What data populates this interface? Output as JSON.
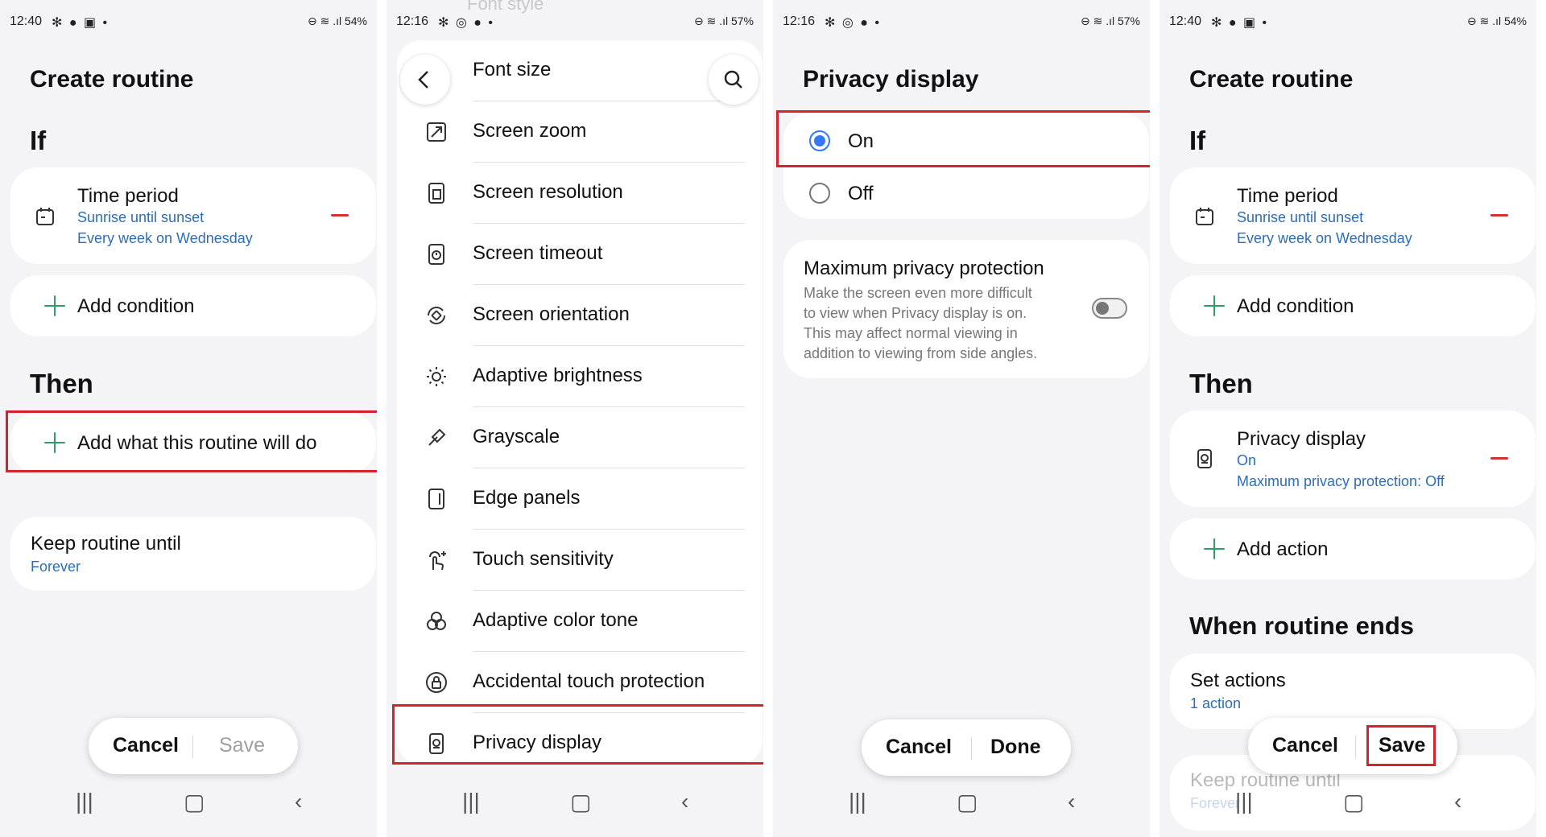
{
  "status_bars": [
    {
      "time": "12:40",
      "icons": "✻ ● ▣ •",
      "right": "⊖ ≋ .ıl 54%"
    },
    {
      "time": "12:16",
      "icons": "✻ ◎ ● •",
      "right": "⊖ ≋ .ıl 57%"
    },
    {
      "time": "12:16",
      "icons": "✻ ◎ ● •",
      "right": "⊖ ≋ .ıl 57%"
    },
    {
      "time": "12:40",
      "icons": "✻ ● ▣ •",
      "right": "⊖ ≋ .ıl 54%"
    }
  ],
  "screen1": {
    "title": "Create routine",
    "if_label": "If",
    "condition": {
      "title": "Time period",
      "line1": "Sunrise until sunset",
      "line2": "Every week on  Wednesday"
    },
    "add_condition": "Add condition",
    "then_label": "Then",
    "add_action": "Add what this routine will do",
    "keep": {
      "title": "Keep routine until",
      "value": "Forever"
    },
    "buttons": {
      "cancel": "Cancel",
      "save": "Save"
    }
  },
  "screen2": {
    "top_partial": "Font style",
    "items": [
      {
        "label": "Font size",
        "icon": "font-size-icon"
      },
      {
        "label": "Screen zoom",
        "icon": "screen-zoom-icon"
      },
      {
        "label": "Screen resolution",
        "icon": "screen-resolution-icon"
      },
      {
        "label": "Screen timeout",
        "icon": "screen-timeout-icon"
      },
      {
        "label": "Screen orientation",
        "icon": "screen-orientation-icon"
      },
      {
        "label": "Adaptive brightness",
        "icon": "brightness-icon"
      },
      {
        "label": "Grayscale",
        "icon": "grayscale-icon"
      },
      {
        "label": "Edge panels",
        "icon": "edge-panels-icon"
      },
      {
        "label": "Touch sensitivity",
        "icon": "touch-sensitivity-icon"
      },
      {
        "label": "Adaptive color tone",
        "icon": "color-tone-icon"
      },
      {
        "label": "Accidental touch protection",
        "icon": "lock-icon"
      },
      {
        "label": "Privacy display",
        "icon": "privacy-display-icon"
      }
    ]
  },
  "screen3": {
    "title": "Privacy display",
    "options": [
      "On",
      "Off"
    ],
    "selected": "On",
    "max": {
      "title": "Maximum privacy protection",
      "desc": [
        "Make the screen even more difficult",
        "to view when Privacy display is on.",
        "This may affect normal viewing in",
        "addition to viewing from side angles."
      ],
      "enabled": false
    },
    "buttons": {
      "cancel": "Cancel",
      "done": "Done"
    }
  },
  "screen4": {
    "title": "Create routine",
    "if_label": "If",
    "condition": {
      "title": "Time period",
      "line1": "Sunrise until sunset",
      "line2": "Every week on  Wednesday"
    },
    "add_condition": "Add condition",
    "then_label": "Then",
    "action": {
      "title": "Privacy display",
      "line1": "On",
      "line2": "Maximum privacy protection: Off"
    },
    "add_action": "Add action",
    "ends_label": "When routine ends",
    "set_actions": {
      "title": "Set actions",
      "value": "1 action"
    },
    "keep": {
      "title": "Keep routine until",
      "value": "Forever"
    },
    "buttons": {
      "cancel": "Cancel",
      "save": "Save"
    }
  },
  "nav": {
    "recents": "|||",
    "home": "▢",
    "back": "‹"
  }
}
